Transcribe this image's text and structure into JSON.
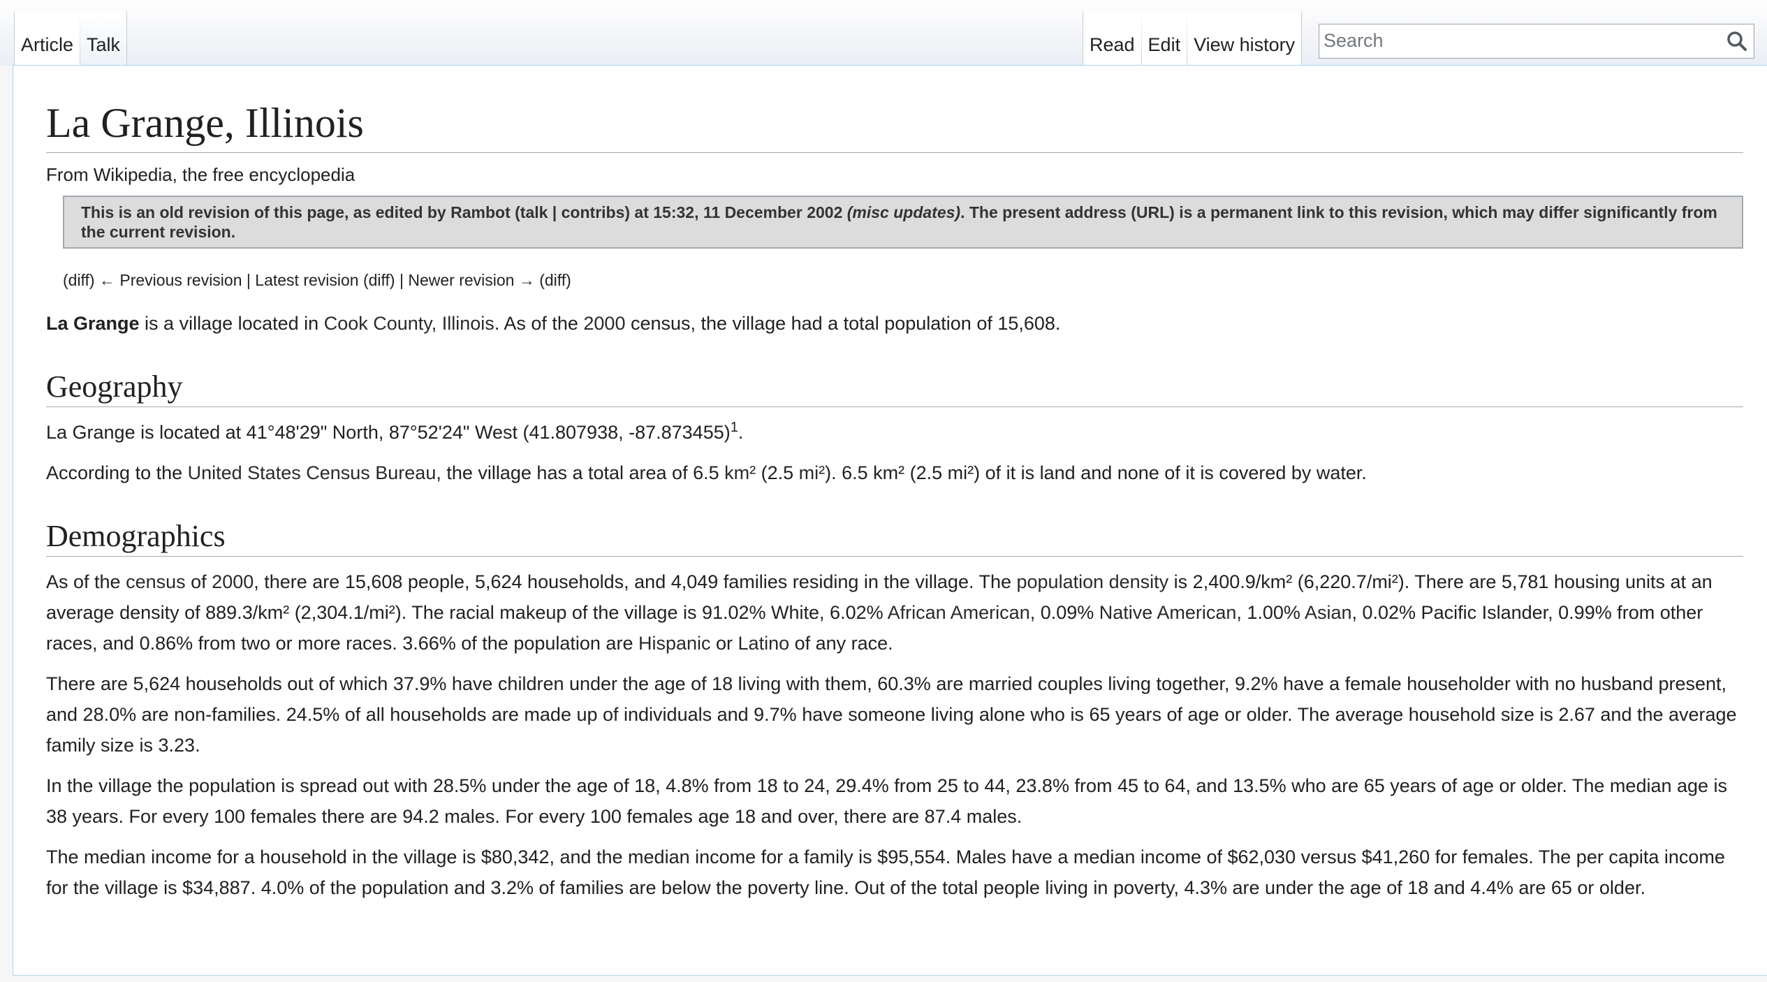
{
  "tabs": {
    "article": "Article",
    "talk": "Talk",
    "read": "Read",
    "edit": "Edit",
    "view_history": "View history"
  },
  "search": {
    "placeholder": "Search",
    "icon": "magnifier-icon"
  },
  "page": {
    "title": "La Grange, Illinois",
    "site_sub": "From Wikipedia, the free encyclopedia",
    "revision_notice": {
      "part1": "This is an old revision of this page, as edited by Rambot (",
      "talk": "talk",
      "sep": " | ",
      "contribs": "contribs",
      "part2": ") at 15:32, 11 December 2002 ",
      "summary": "(misc updates)",
      "part3": ". The present address (URL) is a permanent link to this revision, which may differ significantly from the current revision."
    },
    "revision_nav": {
      "diff1": "(diff)",
      "prev": "← Previous revision",
      "sep1": " | ",
      "latest": "Latest revision",
      "diff2": "(diff)",
      "sep2": " | ",
      "newer": "Newer revision →",
      "diff3": "(diff)"
    },
    "intro": {
      "bold": "La Grange",
      "t1": " is a village located in ",
      "link1": "Cook County, Illinois",
      "t2": ". As of the ",
      "link2": "2000",
      "t3": " census, the village had a total population of 15,608."
    },
    "geography": {
      "heading": "Geography",
      "p1_text": "La Grange is located at 41°48'29\" North, 87°52'24\" West (41.807938, -87.873455)",
      "p1_sup": "1",
      "p1_end": ".",
      "p2_t1": "According to the ",
      "p2_link1": "United States Census Bureau",
      "p2_t2": ", the village has a total area of 6.5 ",
      "p2_link2": "km²",
      "p2_t3": " (2.5 ",
      "p2_link3": "mi²",
      "p2_t4": "). 6.5 km² (2.5 mi²) of it is land and none of it is covered by water."
    },
    "demographics": {
      "heading": "Demographics",
      "p1": {
        "t1": "As of the ",
        "l1": "census",
        "t2": " of ",
        "l2": "2000",
        "t3": ", there are 15,608 people, 5,624 households, and 4,049 families residing in the village. The ",
        "l3": "population density",
        "t4": " is 2,400.9/km² (6,220.7/mi²). There are 5,781 housing units at an average density of 889.3/km² (2,304.1/mi²). The racial makeup of the village is 91.02% White, 6.02% ",
        "l4": "African American",
        "t5": ", 0.09% ",
        "l5": "Native American",
        "t6": ", 1.00% ",
        "l6": "Asian",
        "t7": ", 0.02% Pacific Islander, 0.99% from other races, and 0.86% from two or more races. 3.66% of the population are ",
        "l7": "Hispanic",
        "t8": " or ",
        "l8": "Latino",
        "t9": " of any race."
      },
      "p2": "There are 5,624 households out of which 37.9% have children under the age of 18 living with them, 60.3% are married couples living together, 9.2% have a female householder with no husband present, and 28.0% are non-families. 24.5% of all households are made up of individuals and 9.7% have someone living alone who is 65 years of age or older. The average household size is 2.67 and the average family size is 3.23.",
      "p3": "In the village the population is spread out with 28.5% under the age of 18, 4.8% from 18 to 24, 29.4% from 25 to 44, 23.8% from 45 to 64, and 13.5% who are 65 years of age or older. The median age is 38 years. For every 100 females there are 94.2 males. For every 100 females age 18 and over, there are 87.4 males.",
      "p4": "The median income for a household in the village is $80,342, and the median income for a family is $95,554. Males have a median income of $62,030 versus $41,260 for females. The per capita income for the village is $34,887. 4.0% of the population and 3.2% of families are below the poverty line. Out of the total people living in poverty, 4.3% are under the age of 18 and 4.4% are 65 or older."
    }
  }
}
